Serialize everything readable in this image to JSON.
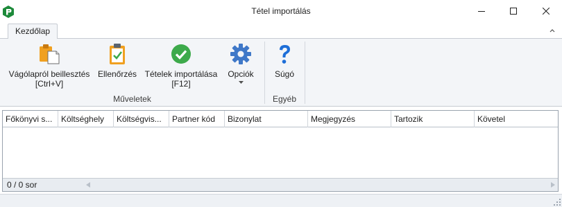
{
  "window": {
    "title": "Tétel importálás",
    "app_logo_icon": "app-logo-icon",
    "controls": {
      "minimize_icon": "minimize-icon",
      "maximize_icon": "maximize-icon",
      "close_icon": "close-icon"
    }
  },
  "tabs": [
    {
      "label": "Kezdőlap",
      "active": true
    }
  ],
  "ribbon": {
    "collapse_icon": "chevron-up-icon",
    "groups": [
      {
        "label": "Műveletek",
        "buttons": [
          {
            "id": "paste",
            "label_line1": "Vágólapról beillesztés",
            "label_line2": "[Ctrl+V]",
            "icon": "paste-icon"
          },
          {
            "id": "check",
            "label_line1": "Ellenőrzés",
            "icon": "clipboard-check-icon"
          },
          {
            "id": "import",
            "label_line1": "Tételek importálása",
            "label_line2": "[F12]",
            "icon": "check-circle-icon"
          },
          {
            "id": "options",
            "label_line1": "Opciók",
            "icon": "gear-icon",
            "has_dropdown": true
          }
        ]
      },
      {
        "label": "Egyéb",
        "buttons": [
          {
            "id": "help",
            "label_line1": "Súgó",
            "icon": "question-icon"
          }
        ]
      }
    ]
  },
  "grid": {
    "columns": [
      "Főkönyvi s...",
      "Költséghely",
      "Költségvis...",
      "Partner kód",
      "Bizonylat",
      "Megjegyzés",
      "Tartozik",
      "Követel"
    ],
    "rows": [],
    "row_count_text": "0 / 0 sor"
  },
  "colors": {
    "accent_green": "#3daa4b",
    "accent_blue": "#1d6ed8",
    "gear_blue": "#3f78c8",
    "paste_orange": "#f0a020"
  }
}
